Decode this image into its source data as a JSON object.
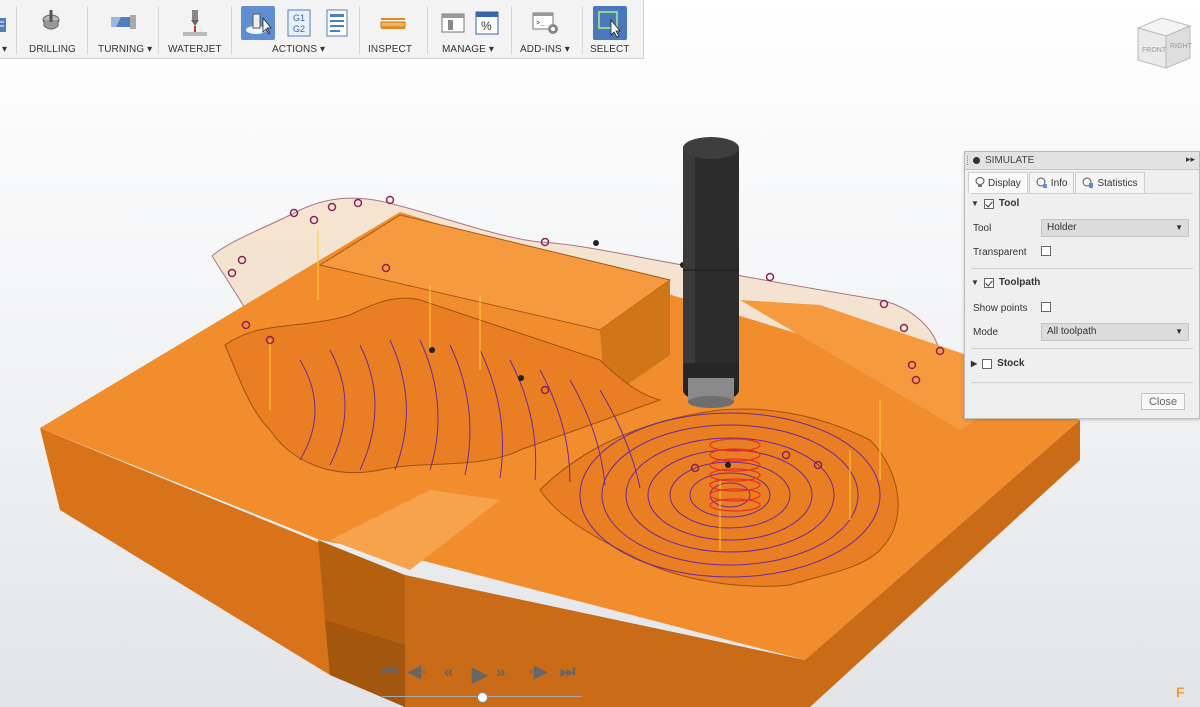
{
  "toolbar": {
    "items": [
      {
        "label": "▾",
        "icon": "partial-tool-icon"
      },
      {
        "label": "DRILLING",
        "icon": "drill-icon"
      },
      {
        "label": "TURNING ▾",
        "icon": "turning-tool-icon"
      },
      {
        "label": "WATERJET",
        "icon": "waterjet-icon"
      },
      {
        "label": "ACTIONS ▾",
        "icon": "simulate-icon"
      },
      {
        "label": "INSPECT",
        "icon": "measure-icon"
      },
      {
        "label": "MANAGE ▾",
        "icon": "tool-library-icon"
      },
      {
        "label": "ADD-INS ▾",
        "icon": "scripts-icon"
      },
      {
        "label": "SELECT",
        "icon": "select-icon"
      }
    ],
    "gcode_label": "G1\nG2"
  },
  "viewcube": {
    "front": "FRONT",
    "right": "RIGHT"
  },
  "panel": {
    "title": "SIMULATE",
    "tabs": [
      {
        "label": "Display",
        "icon": "display-icon"
      },
      {
        "label": "Info",
        "icon": "info-icon"
      },
      {
        "label": "Statistics",
        "icon": "statistics-icon"
      }
    ],
    "tool_section": {
      "label": "Tool",
      "checked": true
    },
    "tool_field": {
      "label": "Tool",
      "value": "Holder"
    },
    "transparent": {
      "label": "Transparent",
      "checked": false
    },
    "toolpath_section": {
      "label": "Toolpath",
      "checked": true
    },
    "show_points": {
      "label": "Show points",
      "checked": false
    },
    "mode_field": {
      "label": "Mode",
      "value": "All toolpath"
    },
    "stock_section": {
      "label": "Stock",
      "checked": false
    },
    "close_label": "Close"
  },
  "playback": {
    "buttons": [
      "skip-to-start-icon",
      "previous-keypoint-icon",
      "rewind-icon",
      "play-icon",
      "fast-forward-icon",
      "next-keypoint-icon",
      "skip-to-end-icon"
    ],
    "progress": 0.5
  },
  "colors": {
    "stock": "#f08a2c",
    "stock_dark": "#c96b17",
    "tool": "#2a2a2a",
    "toolpath": "#6a2b9a",
    "links": "#ffd23c",
    "accent": "#4a78bb"
  },
  "brand_logo": "F"
}
